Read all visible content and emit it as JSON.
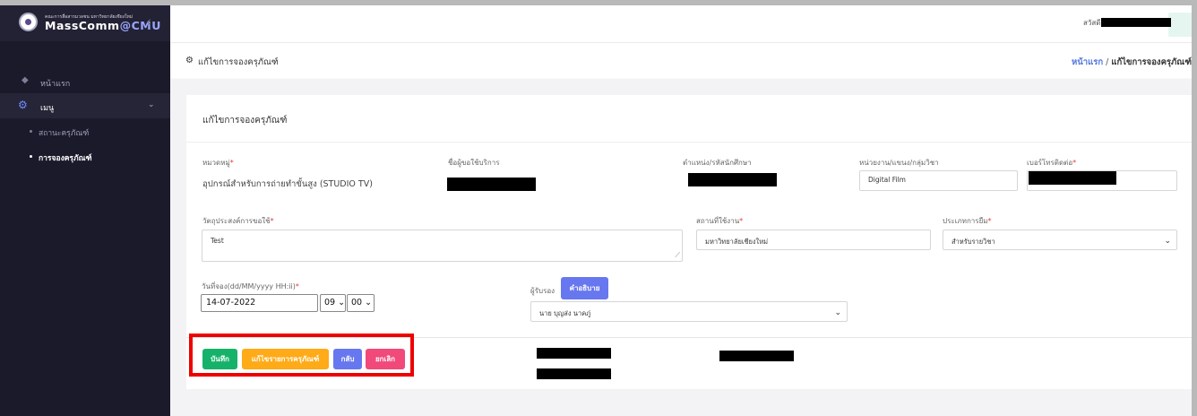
{
  "sidebar": {
    "brand_small": "คณะการสื่อสารมวลชน มหาวิทยาลัยเชียงใหม่",
    "brand_name": "MassComm",
    "brand_at": "@",
    "brand_cmu": "CMU",
    "collapse_icon": "chevron-left-icon",
    "home_label": "หน้าแรก",
    "menu_label": "เมนู",
    "menu_icon": "gears-icon",
    "menu_chevron": "⌄",
    "sub_items": [
      {
        "label": "สถานะครุภัณฑ์"
      },
      {
        "label": "การจองครุภัณฑ์"
      }
    ]
  },
  "topbar": {
    "greeting": "สวัสดี,"
  },
  "header": {
    "title": "แก้ไขการจองครุภัณฑ์",
    "breadcrumb_home": "หน้าแรก",
    "breadcrumb_sep": " / ",
    "breadcrumb_current": "แก้ไขการจองครุภัณฑ์"
  },
  "form": {
    "card_title": "แก้ไขการจองครุภัณฑ์",
    "category_label": "หมวดหมู่",
    "category_value": "อุปกรณ์สำหรับการถ่ายทำขั้นสูง (STUDIO TV)",
    "requester_label": "ชื่อผู้ขอใช้บริการ",
    "position_label": "ตำแหน่ง/รหัสนักศึกษา",
    "department_label": "หน่วยงาน/แขนง/กลุ่มวิชา",
    "department_value": "Digital Film",
    "phone_label": "เบอร์โทรติดต่อ",
    "purpose_label": "วัตถุประสงค์การขอใช้",
    "purpose_value": "Test",
    "place_label": "สถานที่ใช้งาน",
    "place_value": "มหาวิทยาลัยเชียงใหม่",
    "borrow_type_label": "ประเภทการยืม",
    "borrow_type_value": "สำหรับรายวิชา",
    "date_label": "วันที่จอง(dd/MM/yyyy HH:ii)",
    "date_value": "14-07-2022",
    "hour_value": "09",
    "minute_value": "00",
    "receiver_label": "ผู้รับรอง",
    "explain_button": "คำอธิบาย",
    "receiver_value": "นาย บุญส่ง นาคภู่",
    "required_mark": "*"
  },
  "actions": {
    "save": "บันทึก",
    "edit_items": "แก้ไขรายการครุภัณฑ์",
    "back": "กลับ",
    "cancel": "ยกเลิก"
  },
  "colors": {
    "sidebar_bg": "#1b1a2b",
    "link": "#4f74e0",
    "save": "#17b26a",
    "edit": "#ffaa17",
    "back": "#6777ef",
    "cancel": "#f0497a",
    "highlight": "#ee0000"
  }
}
